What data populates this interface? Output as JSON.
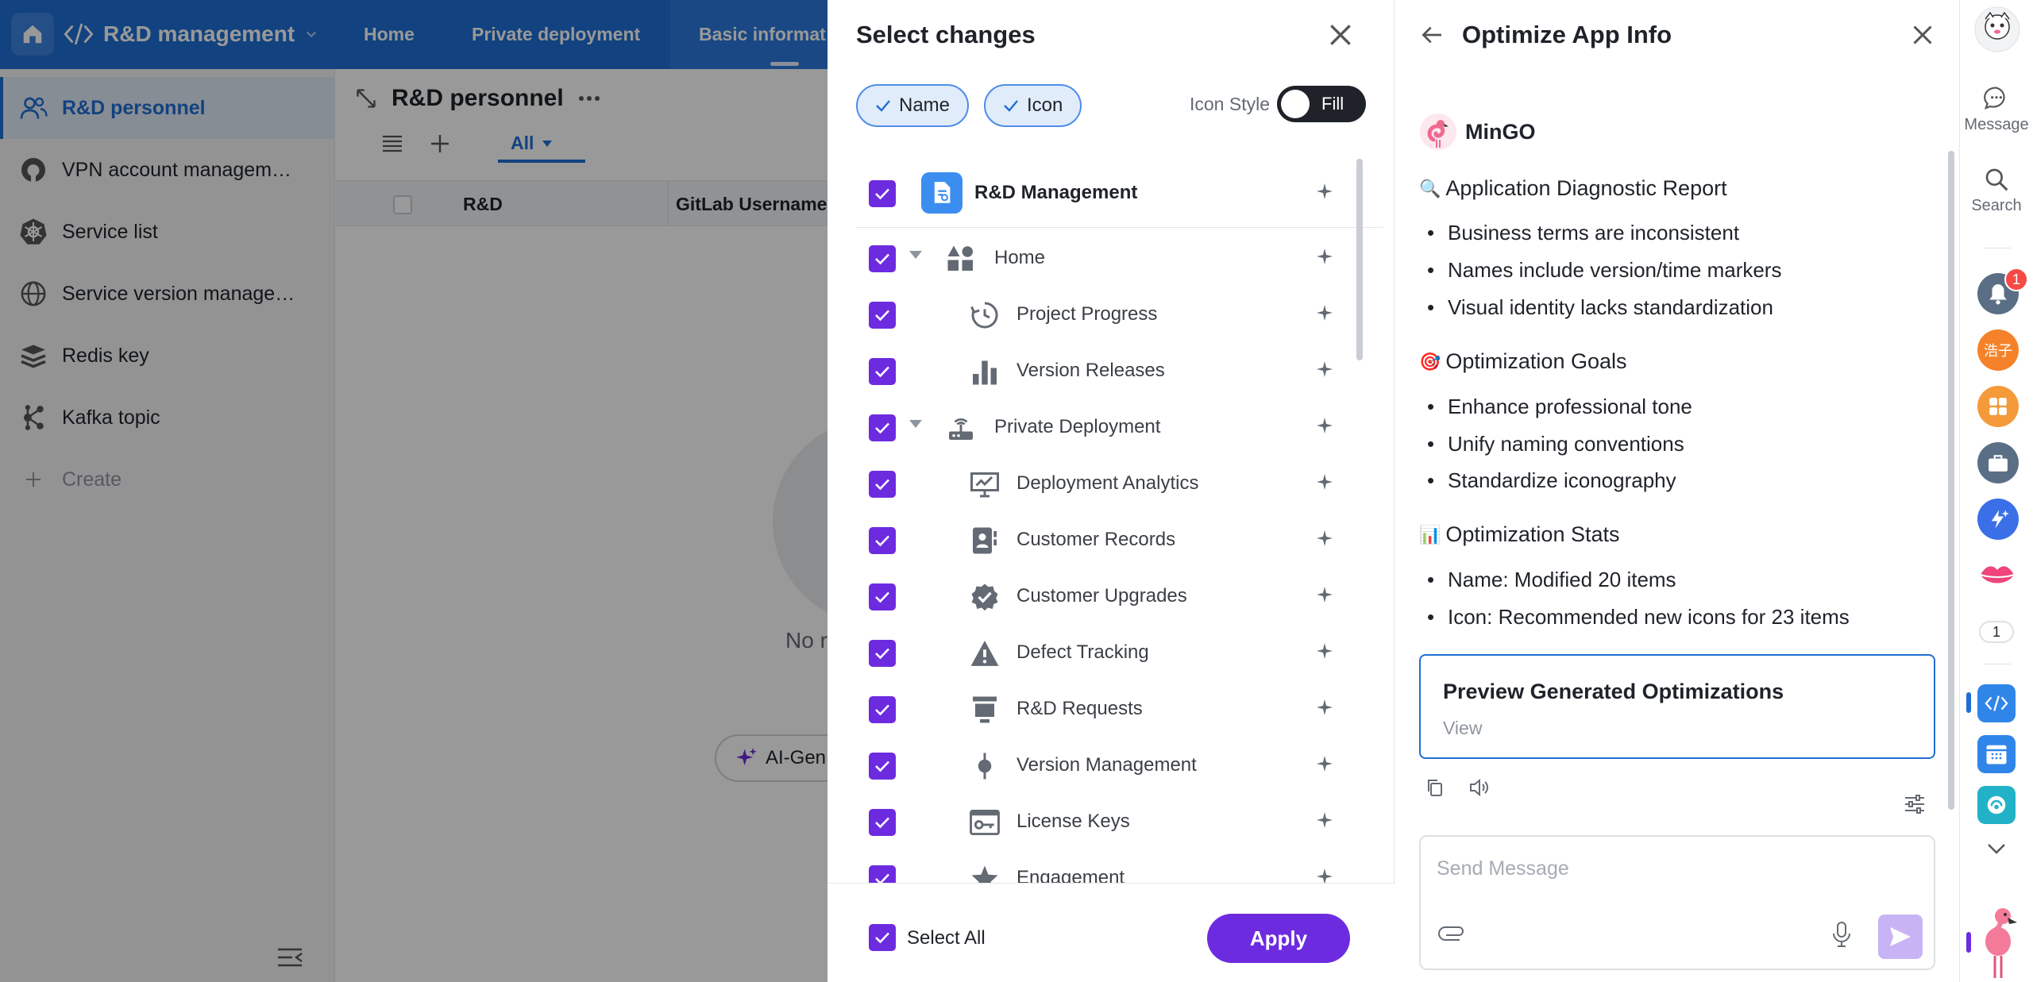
{
  "background_app": {
    "app_name": "R&D management",
    "nav": [
      "Home",
      "Private deployment",
      "Basic informat"
    ],
    "sidebar": [
      {
        "label": "R&D personnel",
        "icon": "people-icon"
      },
      {
        "label": "VPN account managem…",
        "icon": "vpn-icon"
      },
      {
        "label": "Service list",
        "icon": "kubernetes-icon"
      },
      {
        "label": "Service version manage…",
        "icon": "globe-icon"
      },
      {
        "label": "Redis key",
        "icon": "redis-icon"
      },
      {
        "label": "Kafka topic",
        "icon": "kafka-icon"
      }
    ],
    "create_label": "Create",
    "page_title": "R&D personnel",
    "tab_all": "All",
    "columns": [
      "R&D",
      "GitLab Username"
    ],
    "empty_text": "No r",
    "ai_button": "AI-Gen"
  },
  "select_panel": {
    "title": "Select changes",
    "chips": [
      "Name",
      "Icon"
    ],
    "icon_style_label": "Icon Style",
    "toggle_label": "Fill",
    "root": {
      "label": "R&D Management"
    },
    "items": [
      {
        "label": "Home",
        "level": 0,
        "expandable": true,
        "icon": "shapes-icon"
      },
      {
        "label": "Project Progress",
        "level": 1,
        "icon": "progress-clock-icon"
      },
      {
        "label": "Version Releases",
        "level": 1,
        "icon": "bar-chart-icon"
      },
      {
        "label": "Private Deployment",
        "level": 0,
        "expandable": true,
        "icon": "router-icon"
      },
      {
        "label": "Deployment Analytics",
        "level": 1,
        "icon": "presentation-chart-icon"
      },
      {
        "label": "Customer Records",
        "level": 1,
        "icon": "contact-card-icon"
      },
      {
        "label": "Customer Upgrades",
        "level": 1,
        "icon": "verified-badge-icon"
      },
      {
        "label": "Defect Tracking",
        "level": 1,
        "icon": "warning-icon"
      },
      {
        "label": "R&D Requests",
        "level": 1,
        "icon": "request-stack-icon"
      },
      {
        "label": "Version Management",
        "level": 1,
        "icon": "commit-icon"
      },
      {
        "label": "License Keys",
        "level": 1,
        "icon": "license-key-icon"
      },
      {
        "label": "Engagement",
        "level": 1,
        "icon": "star-icon"
      }
    ],
    "select_all_label": "Select All",
    "apply_label": "Apply"
  },
  "optimize_panel": {
    "title": "Optimize App Info",
    "bot_name": "MinGO",
    "sections": [
      {
        "emoji": "🔍",
        "heading": "Application Diagnostic Report",
        "bullets": [
          "Business terms are inconsistent",
          "Names include version/time markers",
          "Visual identity lacks standardization"
        ]
      },
      {
        "emoji": "🎯",
        "heading": "Optimization Goals",
        "bullets": [
          "Enhance professional tone",
          "Unify naming conventions",
          "Standardize iconography"
        ]
      },
      {
        "emoji": "📊",
        "heading": "Optimization Stats",
        "bullets": [
          "Name: Modified 20 items",
          "Icon: Recommended new icons for 23 items"
        ]
      }
    ],
    "card_title": "Preview Generated Optimizations",
    "card_view": "View",
    "composer_placeholder": "Send Message"
  },
  "rail": {
    "message_label": "Message",
    "search_label": "Search",
    "notification_count": "1",
    "avatar_text": "浩子",
    "unread_pill": "1"
  },
  "colors": {
    "nav_blue": "#1f6ed4",
    "accent_purple": "#6d2be0",
    "chip_bg": "#e1ecfb"
  }
}
